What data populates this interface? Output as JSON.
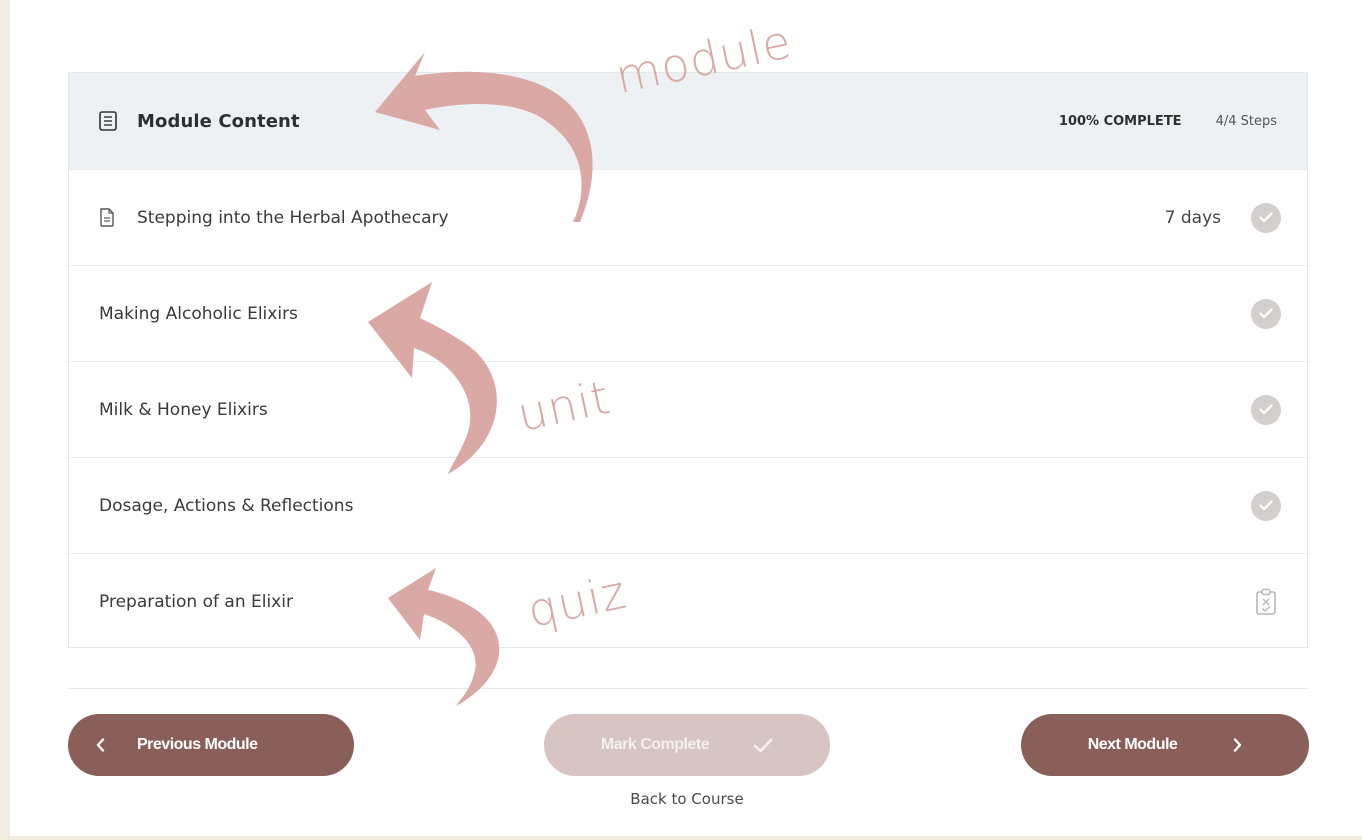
{
  "module": {
    "title": "Module Content",
    "progress_percent": "100% COMPLETE",
    "steps": "4/4 Steps"
  },
  "items": [
    {
      "label": "Stepping into the Herbal Apothecary",
      "meta": "7 days",
      "icon": "document-icon",
      "status": "complete"
    },
    {
      "label": "Making Alcoholic Elixirs",
      "status": "complete"
    },
    {
      "label": "Milk & Honey Elixirs",
      "status": "complete"
    },
    {
      "label": "Dosage, Actions & Reflections",
      "status": "complete"
    },
    {
      "label": "Preparation of an Elixir",
      "icon": "quiz-icon",
      "status": "quiz"
    }
  ],
  "nav": {
    "previous_label": "Previous Module",
    "mark_complete_label": "Mark Complete",
    "next_label": "Next Module",
    "back_label": "Back to Course"
  },
  "annotations": {
    "module": "module",
    "unit": "unit",
    "quiz": "quiz"
  },
  "colors": {
    "page_background": "#f3eddf",
    "header_background": "#edf1f4",
    "button_brown": "#8a5e59",
    "button_disabled": "#d6c5c2",
    "check_grey": "#d3cfcf",
    "annotation_pink": "#dba9a5"
  }
}
